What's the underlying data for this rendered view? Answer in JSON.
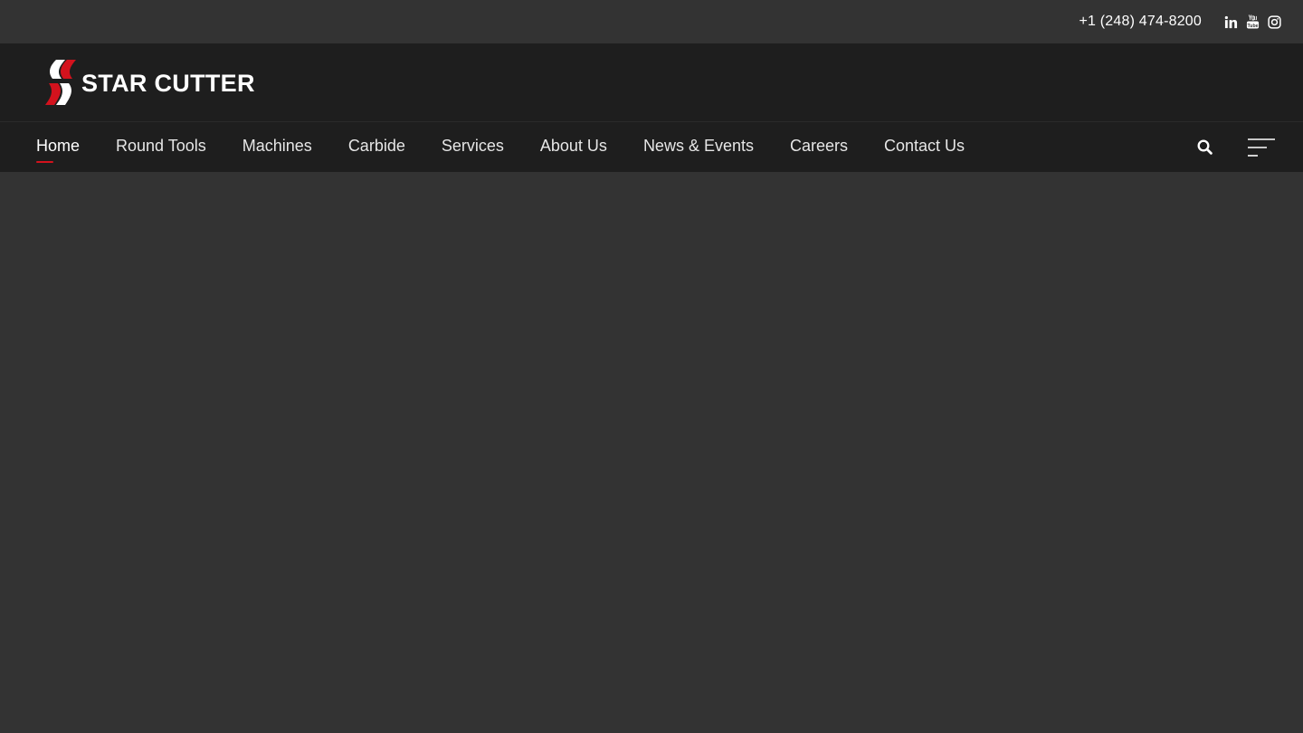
{
  "topbar": {
    "phone": "+1 (248) 474-8200",
    "social": [
      {
        "icon": "linkedin-icon"
      },
      {
        "icon": "youtube-icon"
      },
      {
        "icon": "instagram-icon"
      }
    ]
  },
  "brand": {
    "name": "STAR CUTTER",
    "accent_color": "#d3121d"
  },
  "nav": {
    "items": [
      {
        "label": "Home",
        "active": true
      },
      {
        "label": "Round Tools"
      },
      {
        "label": "Machines"
      },
      {
        "label": "Carbide"
      },
      {
        "label": "Services"
      },
      {
        "label": "About Us"
      },
      {
        "label": "News & Events"
      },
      {
        "label": "Careers"
      },
      {
        "label": "Contact Us"
      }
    ],
    "tools": [
      {
        "icon": "search-icon"
      },
      {
        "icon": "menu-icon"
      }
    ]
  },
  "colors": {
    "topbar_bg": "#333333",
    "header_bg": "#1e1e1e",
    "body_bg": "#333333",
    "text": "#ffffff"
  }
}
